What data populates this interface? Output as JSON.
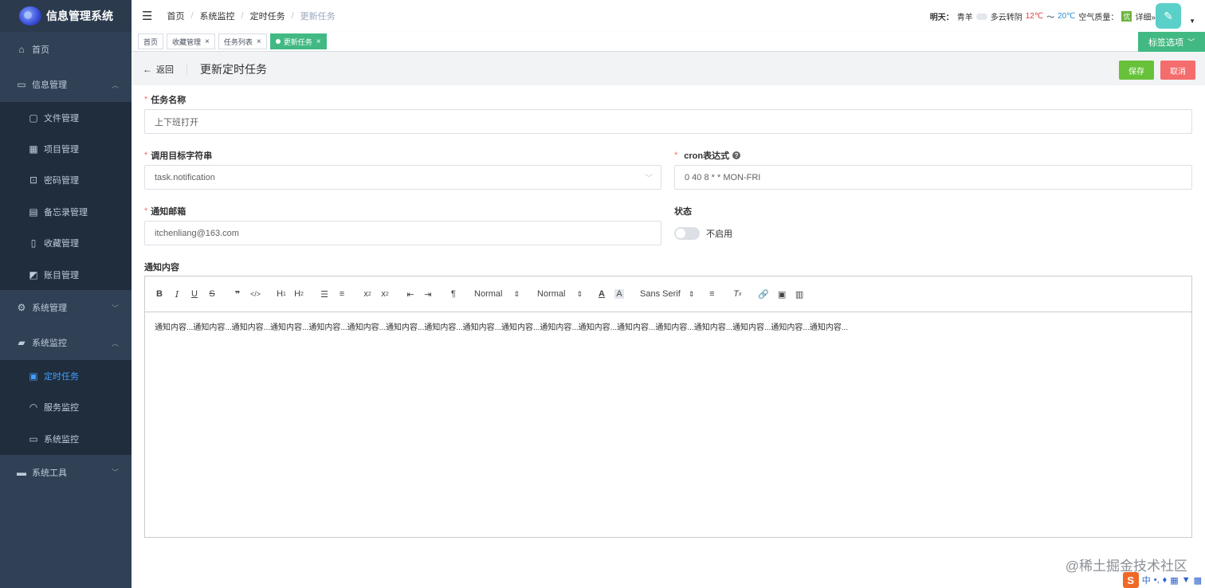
{
  "app": {
    "title": "信息管理系统"
  },
  "sidebar": {
    "home": "首页",
    "info_mgmt": {
      "label": "信息管理",
      "items": [
        "文件管理",
        "项目管理",
        "密码管理",
        "备忘录管理",
        "收藏管理",
        "账目管理"
      ]
    },
    "system_mgmt": "系统管理",
    "system_monitor": {
      "label": "系统监控",
      "items": [
        "定时任务",
        "服务监控",
        "系统监控"
      ]
    },
    "system_tools": "系统工具"
  },
  "header": {
    "breadcrumb": [
      "首页",
      "系统监控",
      "定时任务",
      "更新任务"
    ],
    "weather": {
      "label": "明天：",
      "city": "青羊",
      "condition": "多云转阴",
      "high": "12℃",
      "tilde": "～",
      "low": "20℃",
      "aq_label": "空气质量：",
      "aq_value": "优",
      "detail": "详细»"
    }
  },
  "tags": {
    "items": [
      {
        "label": "首页",
        "closable": false
      },
      {
        "label": "收藏管理",
        "closable": true
      },
      {
        "label": "任务列表",
        "closable": true
      },
      {
        "label": "更新任务",
        "closable": true,
        "active": true
      }
    ],
    "options": "标签选项"
  },
  "page": {
    "back": "返回",
    "title": "更新定时任务",
    "save": "保存",
    "cancel": "取消"
  },
  "form": {
    "task_name": {
      "label": "任务名称",
      "value": "上下班打开"
    },
    "invoke_target": {
      "label": "调用目标字符串",
      "value": "task.notification"
    },
    "cron": {
      "label": "cron表达式",
      "value": "0 40 8 * * MON-FRI"
    },
    "email": {
      "label": "通知邮箱",
      "value": "itchenliang@163.com"
    },
    "status": {
      "label": "状态",
      "value": "不启用",
      "enabled": false
    },
    "content": {
      "label": "通知内容",
      "toolbar": {
        "header": "Normal",
        "size": "Normal",
        "font": "Sans Serif"
      },
      "body": "通知内容...通知内容...通知内容...通知内容...通知内容...通知内容...通知内容...通知内容...通知内容...通知内容...通知内容...通知内容...通知内容...通知内容...通知内容...通知内容...通知内容...通知内容..."
    }
  },
  "watermark": "@稀土掘金技术社区",
  "ime": {
    "brand": "S",
    "lang": "中"
  },
  "colors": {
    "sidebar": "#304156",
    "active": "#409eff",
    "tag_active": "#42b983",
    "save": "#67c23a",
    "cancel": "#f56c6c"
  }
}
